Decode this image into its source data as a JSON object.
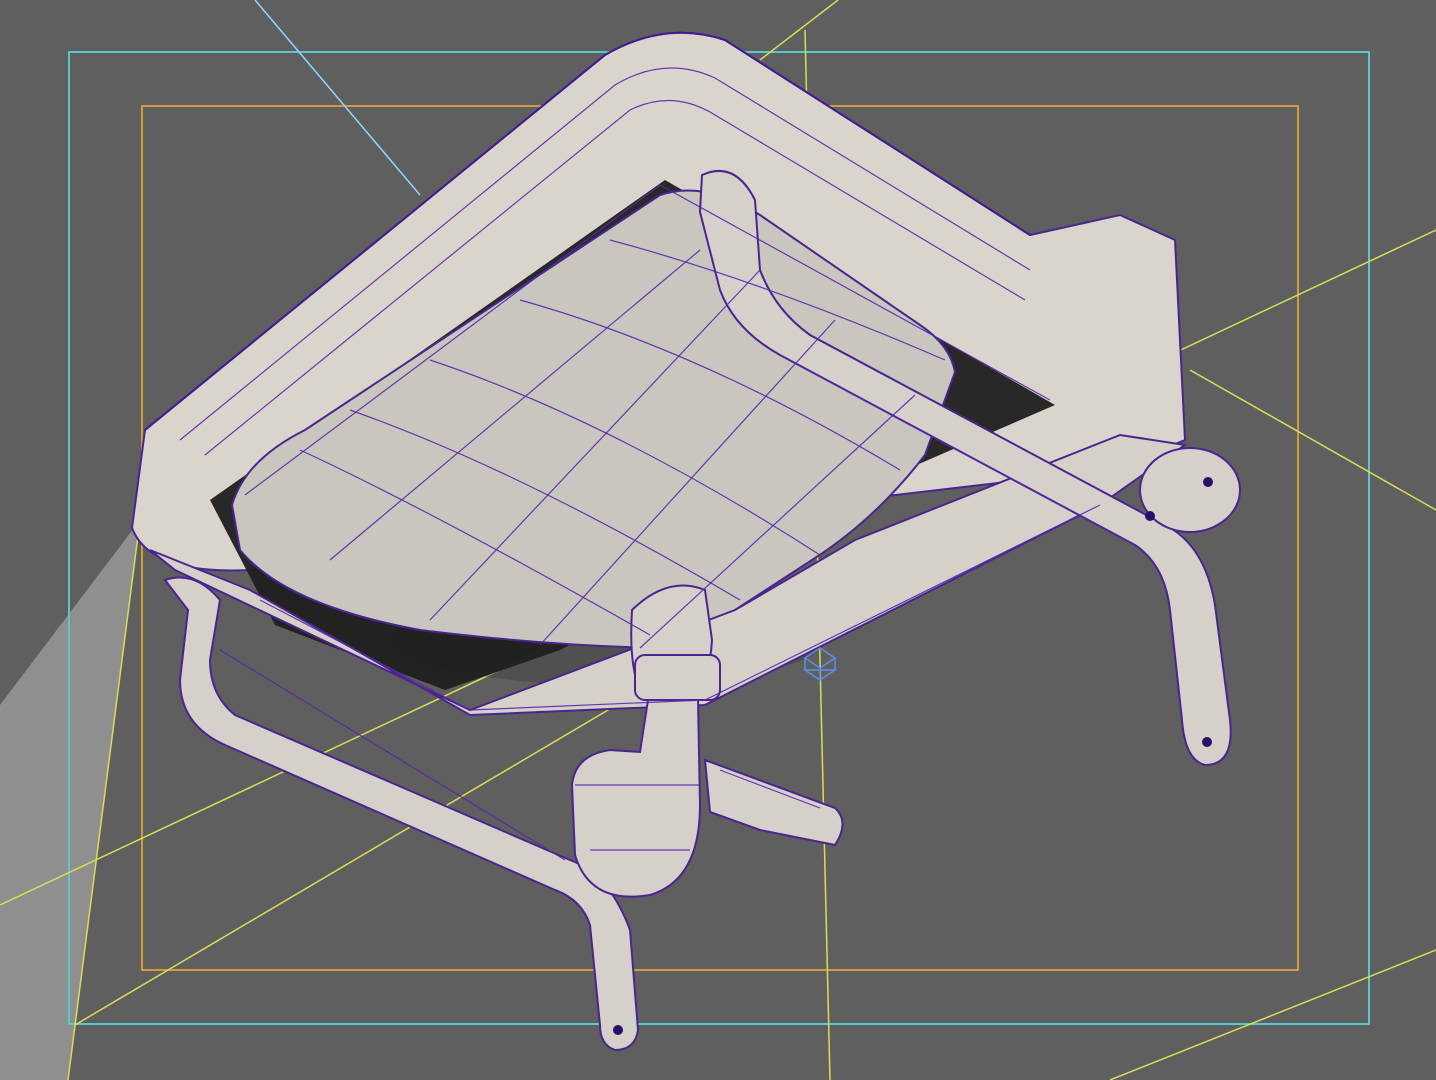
{
  "viewport": {
    "background": "#5f5f5f"
  },
  "guides": {
    "safe_frame_color": "#57c8cf",
    "title_safe_color": "#d59a3e",
    "camera_line_color": "#8fd8ff",
    "guide_line_color": "#d8dd54"
  },
  "model": {
    "wireframe_color": "#5628aa",
    "surface_color": "#d9d5cd"
  },
  "icons": {
    "pivot": "pivot-icon"
  }
}
